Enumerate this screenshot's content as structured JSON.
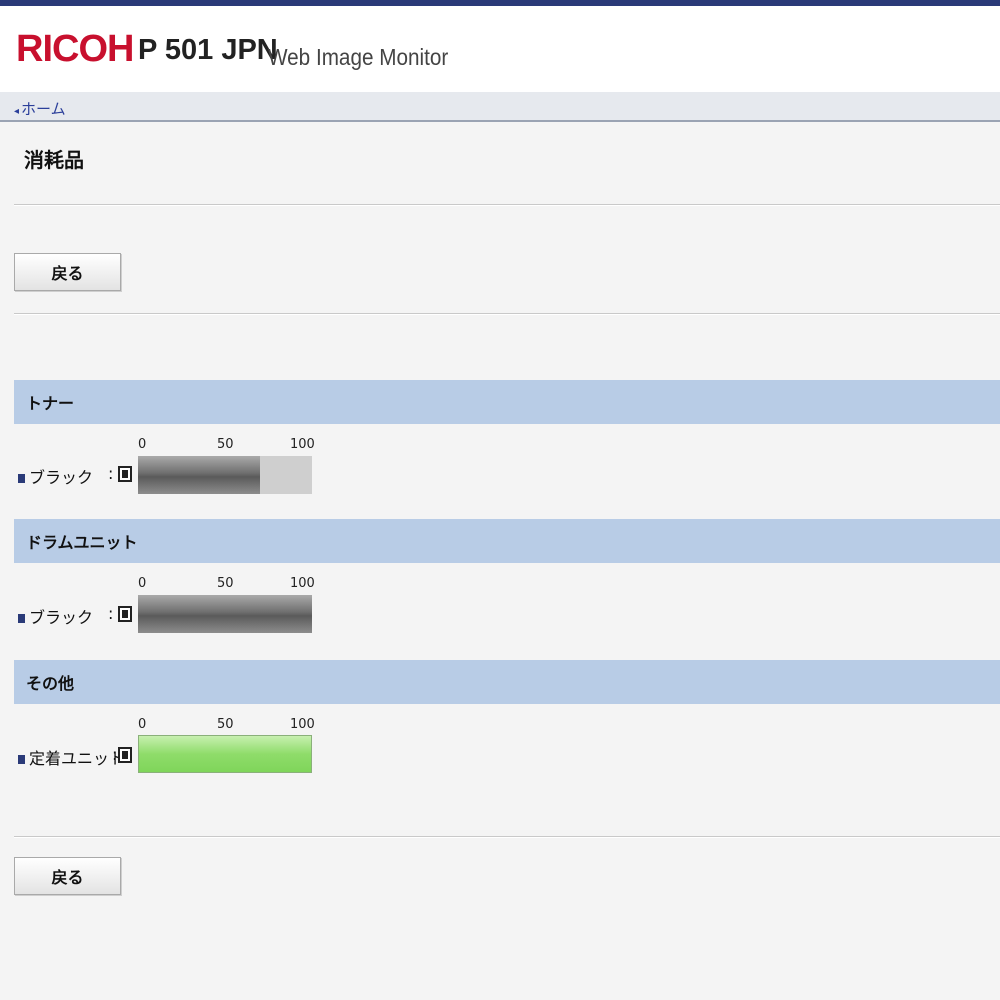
{
  "header": {
    "brand": "RICOH",
    "model": "P 501 JPN",
    "app_name": "Web Image Monitor"
  },
  "breadcrumb": {
    "home": "ホーム"
  },
  "page": {
    "title": "消耗品"
  },
  "buttons": {
    "back_top": "戻る",
    "back_bottom": "戻る"
  },
  "scale": {
    "min": "0",
    "mid": "50",
    "max": "100"
  },
  "sections": [
    {
      "title": "トナー",
      "items": [
        {
          "label": "ブラック",
          "colon": ":",
          "level_percent": 70,
          "color": "gray"
        }
      ]
    },
    {
      "title": "ドラムユニット",
      "items": [
        {
          "label": "ブラック",
          "colon": ":",
          "level_percent": 100,
          "color": "gray"
        }
      ]
    },
    {
      "title": "その他",
      "items": [
        {
          "label": "定着ユニット",
          "colon": ":",
          "level_percent": 100,
          "color": "green"
        }
      ]
    }
  ],
  "colors": {
    "brand": "#c8102e",
    "section_header": "#b8cce6",
    "link": "#2b3f9a",
    "bar_gray": "#6f6f6f",
    "bar_green": "#8fdc6a",
    "bar_track": "#cfcfcf"
  }
}
